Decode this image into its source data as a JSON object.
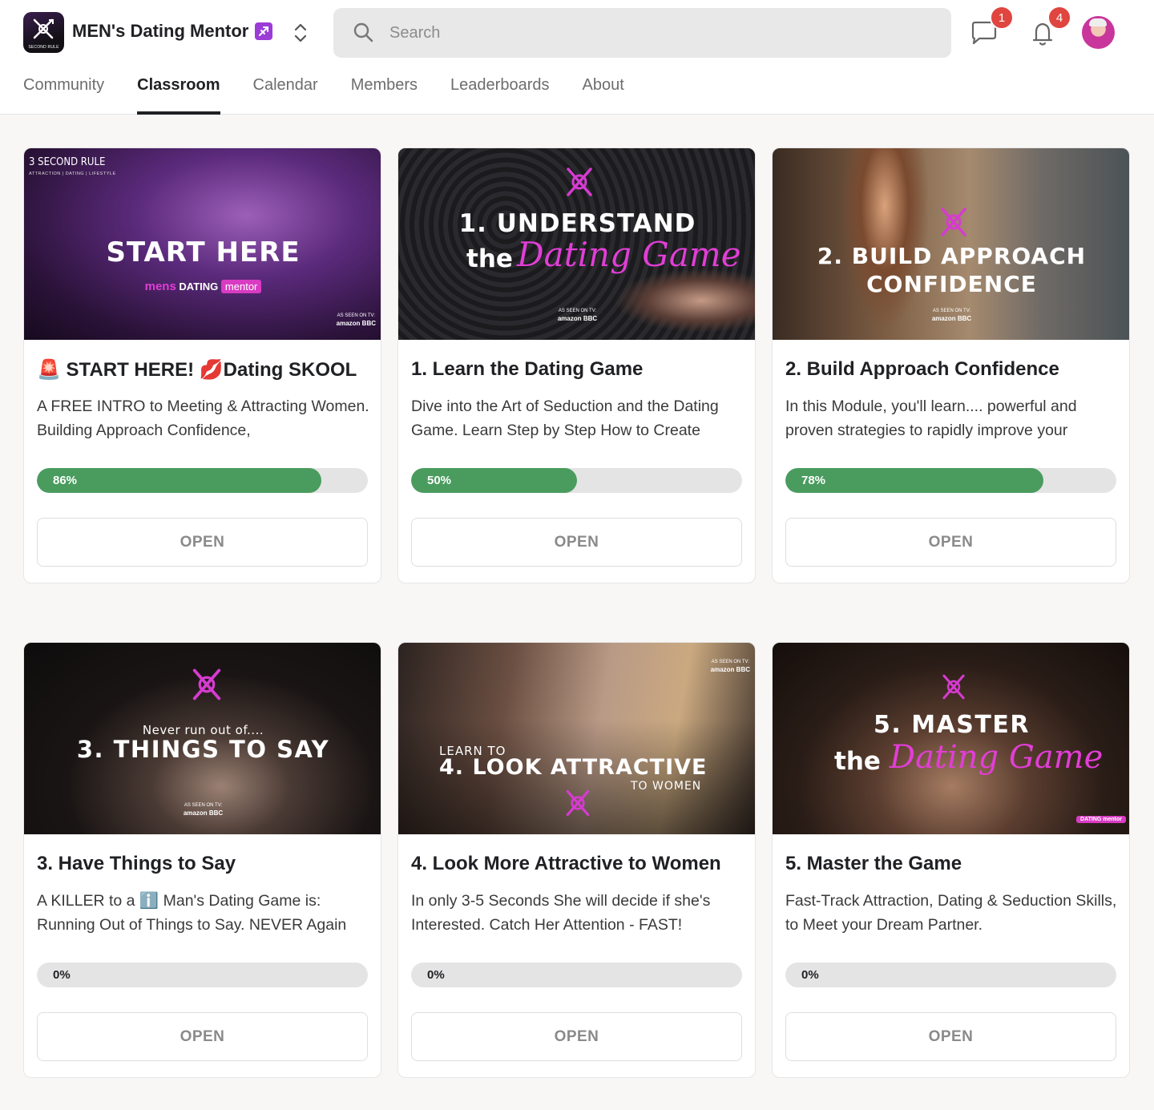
{
  "header": {
    "brand_name": "MEN's Dating Mentor",
    "logo_text": "SECOND RULE",
    "search_placeholder": "Search",
    "chat_count": "1",
    "notification_count": "4"
  },
  "tabs": [
    {
      "label": "Community"
    },
    {
      "label": "Classroom"
    },
    {
      "label": "Calendar"
    },
    {
      "label": "Members"
    },
    {
      "label": "Leaderboards"
    },
    {
      "label": "About"
    }
  ],
  "active_tab": "Classroom",
  "colors": {
    "progress": "#4a9c5e",
    "accent_pink": "#e13ed6",
    "badge": "#e0453f"
  },
  "courses": [
    {
      "title": "🚨 START HERE! 💋Dating SKOOL",
      "description": "A FREE INTRO to Meeting & Attracting Women. Building Approach Confidence,",
      "progress": 86,
      "progress_label": "86%",
      "button": "OPEN",
      "thumb": {
        "line1": "START HERE",
        "brand_a": "mens",
        "brand_b": "DATING",
        "brand_c": "mentor",
        "corner": "3 SECOND RULE",
        "corner_sub": "ATTRACTION | DATING | LIFESTYLE",
        "seen": "AS SEEN ON TV:",
        "seen_logos": "amazon BBC"
      }
    },
    {
      "title": "1. Learn the Dating Game",
      "description": "Dive into the Art of Seduction and the Dating Game. Learn Step by Step How to Create",
      "progress": 50,
      "progress_label": "50%",
      "button": "OPEN",
      "thumb": {
        "line1": "1. UNDERSTAND",
        "line2a": "the",
        "line2b": "Dating Game",
        "seen": "AS SEEN ON TV:",
        "seen_logos": "amazon BBC"
      }
    },
    {
      "title": "2. Build Approach Confidence",
      "description": "In this Module, you'll learn.... powerful and proven strategies to rapidly improve your",
      "progress": 78,
      "progress_label": "78%",
      "button": "OPEN",
      "thumb": {
        "line1": "2. BUILD APPROACH",
        "line2": "CONFIDENCE",
        "seen": "AS SEEN ON TV:",
        "seen_logos": "amazon BBC"
      }
    },
    {
      "title": "3. Have Things to Say",
      "description": "A KILLER to a ℹ️ Man's Dating Game is: Running Out of Things to Say. NEVER Again",
      "progress": 0,
      "progress_label": "0%",
      "button": "OPEN",
      "thumb": {
        "line1": "Never run out of....",
        "line2": "3. THINGS TO SAY",
        "seen": "AS SEEN ON TV:",
        "seen_logos": "amazon BBC"
      }
    },
    {
      "title": "4. Look More Attractive to Women",
      "description": "In only 3-5 Seconds She will decide if she's Interested. Catch Her Attention - FAST!",
      "progress": 0,
      "progress_label": "0%",
      "button": "OPEN",
      "thumb": {
        "line1": "LEARN TO",
        "line2": "4. LOOK ATTRACTIVE",
        "line3": "TO WOMEN",
        "seen": "AS SEEN ON TV:",
        "seen_logos": "amazon BBC"
      }
    },
    {
      "title": "5. Master the Game",
      "description": "Fast-Track Attraction, Dating & Seduction Skills, to Meet your Dream Partner.",
      "progress": 0,
      "progress_label": "0%",
      "button": "OPEN",
      "thumb": {
        "line1": "5. MASTER",
        "line2a": "the",
        "line2b": "Dating Game",
        "tag": "DATING mentor"
      }
    }
  ]
}
